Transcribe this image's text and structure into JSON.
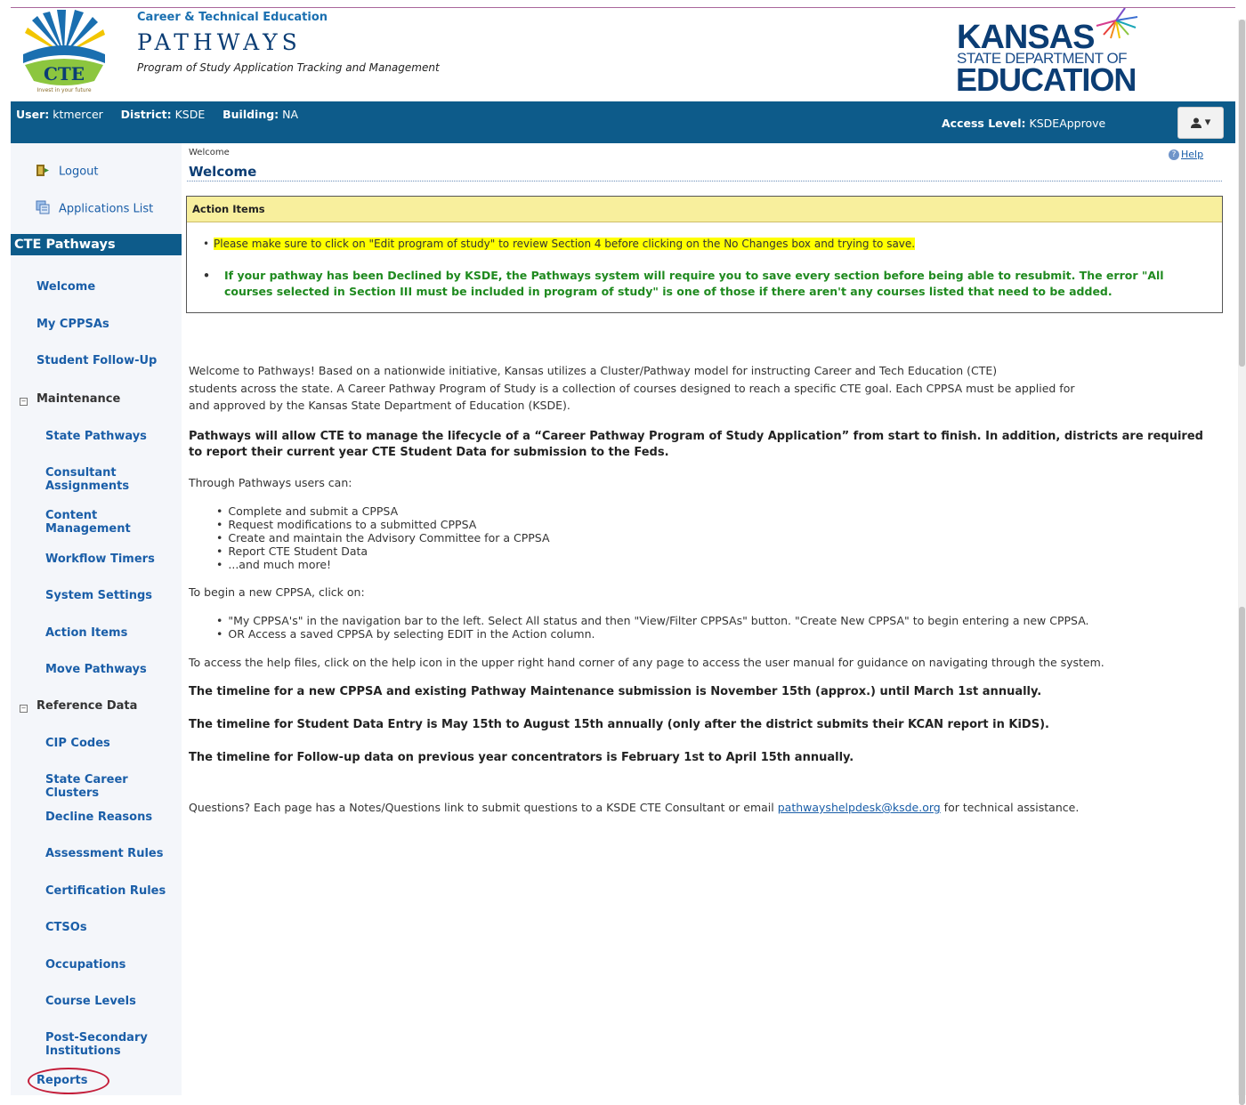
{
  "header": {
    "brand_sub": "Career & Technical Education",
    "brand_title": "PATHWAYS",
    "brand_desc": "Program of Study Application Tracking and Management",
    "logo_cte_text": "CTE",
    "logo_cte_tagline": "Invest in your future",
    "ksde_line1": "KANSAS",
    "ksde_line2": "STATE DEPARTMENT OF",
    "ksde_line3": "EDUCATION"
  },
  "userbar": {
    "user_label": "User:",
    "user_value": "ktmercer",
    "district_label": "District:",
    "district_value": "KSDE",
    "building_label": "Building:",
    "building_value": "NA",
    "access_label": "Access Level:",
    "access_value": "KSDEApprove",
    "menu_caret": "▾"
  },
  "sidebar": {
    "logout": "Logout",
    "applications_list": "Applications List",
    "section_title": "CTE Pathways",
    "welcome": "Welcome",
    "my_cppsas": "My CPPSAs",
    "student_follow_up": "Student Follow-Up",
    "maintenance": "Maintenance",
    "state_pathways": "State Pathways",
    "consultant_assignments_1": "Consultant",
    "consultant_assignments_2": "Assignments",
    "content_management_1": "Content",
    "content_management_2": "Management",
    "workflow_timers": "Workflow Timers",
    "system_settings": "System Settings",
    "action_items": "Action Items",
    "move_pathways": "Move Pathways",
    "reference_data": "Reference Data",
    "cip_codes": "CIP Codes",
    "state_career_clusters": "State Career Clusters",
    "decline_reasons": "Decline Reasons",
    "assessment_rules": "Assessment Rules",
    "certification_rules": "Certification Rules",
    "ctsos": "CTSOs",
    "occupations": "Occupations",
    "course_levels": "Course Levels",
    "post_secondary_1": "Post-Secondary",
    "post_secondary_2": "Institutions",
    "reports": "Reports"
  },
  "main": {
    "breadcrumb": "Welcome",
    "title": "Welcome",
    "help": "Help",
    "action_items_title": "Action Items",
    "action_item_1": "Please make sure to click on \"Edit program of study\" to review Section 4 before clicking on the No Changes box and trying to save.",
    "action_item_2": "If your pathway has been Declined by KSDE, the Pathways system will require you to save every section before being able to resubmit.  The error \"All courses selected in Section III must be included in program of study\" is one of those if there aren't any courses listed that need to be added.",
    "intro_1": "Welcome to Pathways! Based on a nationwide initiative, Kansas utilizes a Cluster/Pathway model for instructing Career and Tech Education (CTE)",
    "intro_2": "students across the state. A Career Pathway Program of Study is a collection of courses designed to reach a specific CTE goal. Each CPPSA must be applied for",
    "intro_3": "and approved by the Kansas State Department of Education (KSDE).",
    "lifecycle": "Pathways will allow CTE to manage the lifecycle of a “Career Pathway Program of Study Application” from start to finish. In addition, districts are required to report their current year CTE Student Data for submission to the Feds.",
    "through": "Through Pathways users can:",
    "can_list": [
      "Complete and submit a CPPSA",
      "Request modifications to a submitted CPPSA",
      "Create and maintain the Advisory Committee for a CPPSA",
      "Report CTE Student Data",
      "...and much more!"
    ],
    "begin": "To begin a new CPPSA, click on:",
    "begin_list": [
      "\"My CPPSA's\" in the navigation bar to the left.  Select All status and then \"View/Filter CPPSAs\" button.  \"Create New CPPSA\" to begin entering a new CPPSA.",
      "OR Access a saved CPPSA by selecting EDIT in the Action column."
    ],
    "help_files": "To access the help files, click on the help icon in the upper right hand corner of any page to access the user manual for guidance on navigating through the system.",
    "timeline_1": "The timeline for a new CPPSA and existing Pathway Maintenance submission is November 15th (approx.) until March 1st annually.",
    "timeline_2": "The timeline for Student Data Entry is May 15th to August 15th annually (only after the district submits their KCAN report in KiDS).",
    "timeline_3": "The timeline for Follow-up data on previous year concentrators is February 1st to April 15th annually.",
    "questions_pre": "Questions? Each page has a Notes/Questions link to submit questions to a KSDE CTE Consultant or email ",
    "questions_email": "pathwayshelpdesk@ksde.org",
    "questions_post": " for technical assistance."
  },
  "colors": {
    "navy": "#0d5b8a",
    "link": "#1a5ea8",
    "action_green": "#1f8a1f",
    "highlight": "#ffff00",
    "oval": "#c41e3a"
  }
}
